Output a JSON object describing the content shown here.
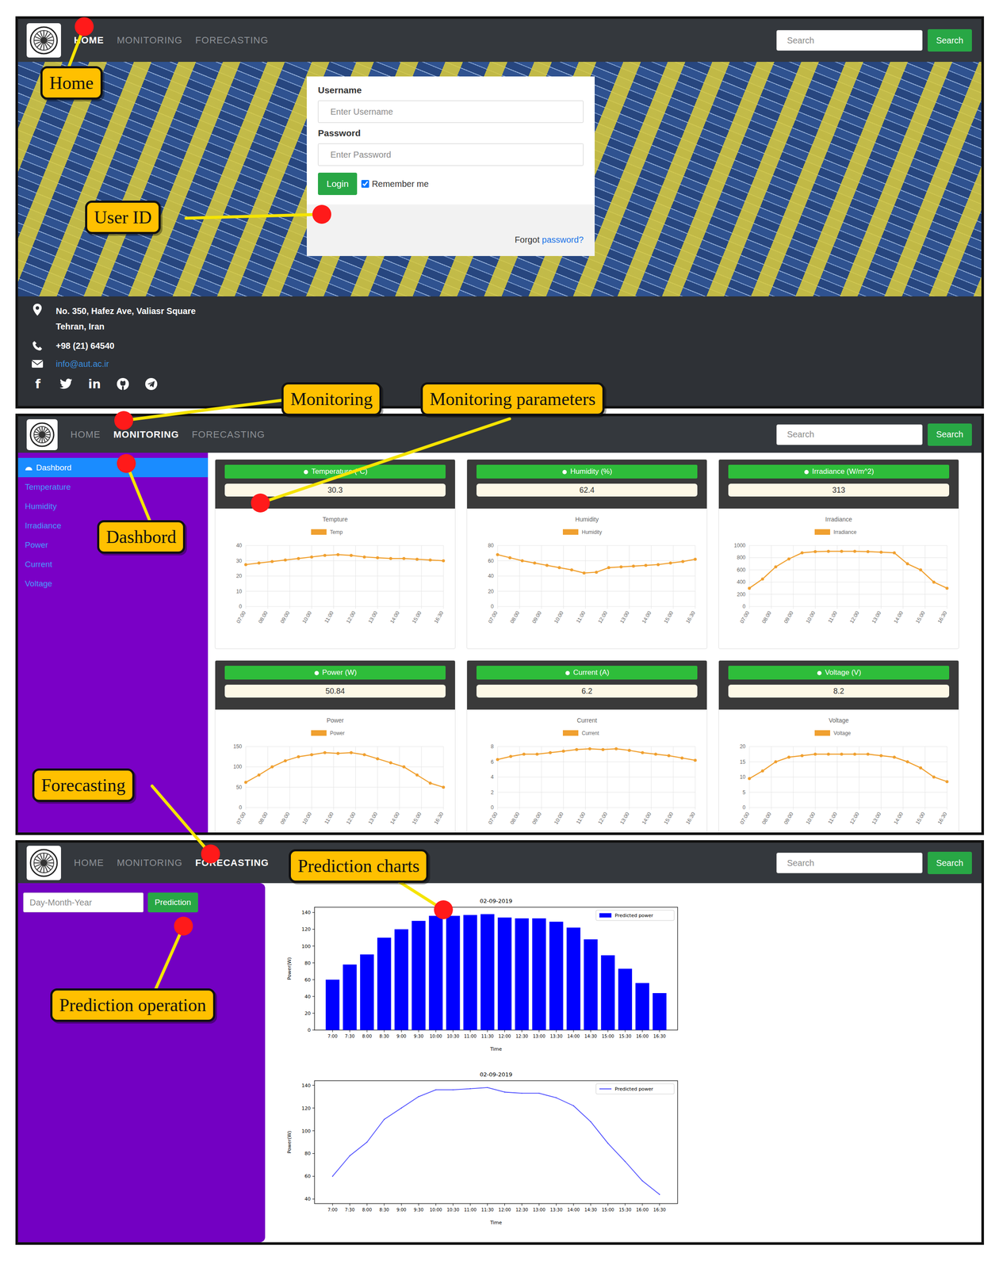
{
  "home": {
    "nav": [
      {
        "label": "HOME",
        "selected": true
      },
      {
        "label": "MONITORING",
        "selected": false
      },
      {
        "label": "FORECASTING",
        "selected": false
      }
    ],
    "search": {
      "placeholder": "Search",
      "button": "Search"
    },
    "login": {
      "username_label": "Username",
      "username_placeholder": "Enter Username",
      "password_label": "Password",
      "password_placeholder": "Enter Password",
      "button": "Login",
      "remember": {
        "label": "Remember me",
        "checked": true
      },
      "forgot": "Forgot",
      "forgot_link": "password?"
    },
    "footer": {
      "address": [
        "No. 350, Hafez Ave, Valiasr Square",
        "Tehran, Iran"
      ],
      "phone": "+98 (21) 64540",
      "email": "info@aut.ac.ir",
      "social": [
        "f",
        "in"
      ]
    }
  },
  "monitoring": {
    "nav": [
      {
        "label": "HOME",
        "selected": false
      },
      {
        "label": "MONITORING",
        "selected": true
      },
      {
        "label": "FORECASTING",
        "selected": false
      }
    ],
    "search": {
      "placeholder": "Search",
      "button": "Search"
    },
    "sidebar": [
      {
        "label": "Dashbord",
        "selected": true
      },
      {
        "label": "Temperature",
        "selected": false
      },
      {
        "label": "Humidity",
        "selected": false
      },
      {
        "label": "Irradiance",
        "selected": false
      },
      {
        "label": "Power",
        "selected": false
      },
      {
        "label": "Current",
        "selected": false
      },
      {
        "label": "Voltage",
        "selected": false
      }
    ],
    "cards": [
      {
        "label": "Temperature (°C)",
        "value": "30.3",
        "chart": {
          "title": "Tempture",
          "legend": "Temp",
          "yticks": [
            "0",
            "10",
            "20",
            "30",
            "40"
          ],
          "xticks": [
            "07:00",
            "08:00",
            "09:00",
            "10:00",
            "11:00",
            "12:00",
            "13:00",
            "14:00",
            "15:00",
            "16:30"
          ],
          "values": [
            27.5,
            28.5,
            29.5,
            30.5,
            31.5,
            32.5,
            33.5,
            34,
            33.5,
            32.5,
            32,
            31.5,
            31.5,
            31,
            30.5,
            30
          ]
        }
      },
      {
        "label": "Humidity (%)",
        "value": "62.4",
        "chart": {
          "title": "Humidity",
          "legend": "Humidity",
          "yticks": [
            "0",
            "20",
            "40",
            "60",
            "80"
          ],
          "xticks": [
            "07:00",
            "08:00",
            "09:00",
            "10:00",
            "11:00",
            "12:00",
            "13:00",
            "14:00",
            "15:00",
            "16:30"
          ],
          "values": [
            68,
            64,
            60,
            57,
            54,
            51,
            48,
            44,
            45,
            51,
            52,
            53,
            54,
            55,
            57,
            59,
            62
          ]
        }
      },
      {
        "label": "Irradiance (W/m^2)",
        "value": "313",
        "chart": {
          "title": "Irradiance",
          "legend": "Irradiance",
          "yticks": [
            "0",
            "200",
            "400",
            "600",
            "800",
            "1000"
          ],
          "xticks": [
            "07:00",
            "08:00",
            "09:00",
            "10:00",
            "11:00",
            "12:00",
            "13:00",
            "14:00",
            "15:00",
            "16:30"
          ],
          "values": [
            300,
            450,
            650,
            780,
            880,
            900,
            905,
            905,
            905,
            900,
            890,
            880,
            700,
            600,
            400,
            300
          ]
        }
      },
      {
        "label": "Power (W)",
        "value": "50.84",
        "chart": {
          "title": "Power",
          "legend": "Power",
          "yticks": [
            "0",
            "50",
            "100",
            "150"
          ],
          "xticks": [
            "07:00",
            "08:00",
            "09:00",
            "10:00",
            "11:00",
            "12:00",
            "13:00",
            "14:00",
            "15:00",
            "16:30"
          ],
          "values": [
            62,
            80,
            100,
            115,
            125,
            130,
            135,
            133,
            135,
            130,
            120,
            110,
            100,
            80,
            60,
            50
          ]
        }
      },
      {
        "label": "Current (A)",
        "value": "6.2",
        "chart": {
          "title": "Current",
          "legend": "Current",
          "yticks": [
            "0",
            "2",
            "4",
            "6",
            "8"
          ],
          "xticks": [
            "07:00",
            "08:00",
            "09:00",
            "10:00",
            "11:00",
            "12:00",
            "13:00",
            "14:00",
            "15:00",
            "16:30"
          ],
          "values": [
            6.3,
            6.7,
            7,
            7,
            7.2,
            7.4,
            7.6,
            7.7,
            7.6,
            7.7,
            7.5,
            7.2,
            7,
            6.8,
            6.5,
            6.2
          ]
        }
      },
      {
        "label": "Voltage (V)",
        "value": "8.2",
        "chart": {
          "title": "Voltage",
          "legend": "Voltage",
          "yticks": [
            "0",
            "5",
            "10",
            "15",
            "20"
          ],
          "xticks": [
            "07:00",
            "08:00",
            "09:00",
            "10:00",
            "11:00",
            "12:00",
            "13:00",
            "14:00",
            "15:00",
            "16:30"
          ],
          "values": [
            9.5,
            12,
            15,
            16.5,
            17,
            17.5,
            17.5,
            17.5,
            17.5,
            17.5,
            17,
            16.5,
            15,
            13,
            10,
            8.5
          ]
        }
      }
    ]
  },
  "forecasting": {
    "nav": [
      {
        "label": "HOME",
        "selected": false
      },
      {
        "label": "MONITORING",
        "selected": false
      },
      {
        "label": "FORECASTING",
        "selected": true
      }
    ],
    "search": {
      "placeholder": "Search",
      "button": "Search"
    },
    "date_placeholder": "Day-Month-Year",
    "button": "Prediction",
    "charts": [
      {
        "kind": "bar",
        "title": "02-09-2019",
        "legend": "Predicted power",
        "ylabel": "Power(W)",
        "xlabel": "Time",
        "yticks": [
          "0",
          "20",
          "40",
          "60",
          "80",
          "100",
          "120",
          "140"
        ],
        "xticks": [
          "7:00",
          "7:30",
          "8:00",
          "8:30",
          "9:00",
          "9:30",
          "10:00",
          "10:30",
          "11:00",
          "11:30",
          "12:00",
          "12:30",
          "13:00",
          "13:30",
          "14:00",
          "14:30",
          "15:00",
          "15:30",
          "16:00",
          "16:30"
        ],
        "values": [
          60,
          78,
          90,
          110,
          120,
          130,
          136,
          136,
          137,
          138,
          134,
          133,
          133,
          129,
          122,
          108,
          89,
          73,
          56,
          44
        ]
      },
      {
        "kind": "line",
        "title": "02-09-2019",
        "legend": "Predicted power",
        "ylabel": "Power(W)",
        "xlabel": "Time",
        "yticks": [
          "40",
          "60",
          "80",
          "100",
          "120",
          "140"
        ],
        "xticks": [
          "7:00",
          "7:30",
          "8:00",
          "8:30",
          "9:00",
          "9:30",
          "10:00",
          "10:30",
          "11:00",
          "11:30",
          "12:00",
          "12:30",
          "13:00",
          "13:30",
          "14:00",
          "14:30",
          "15:00",
          "15:30",
          "16:00",
          "16:30"
        ],
        "values": [
          60,
          78,
          90,
          110,
          120,
          130,
          136,
          136,
          137,
          138,
          134,
          133,
          133,
          129,
          122,
          108,
          89,
          73,
          56,
          44
        ]
      }
    ]
  },
  "callouts": [
    "Home",
    "User ID",
    "Monitoring",
    "Monitoring parameters",
    "Dashbord",
    "Forecasting",
    "Prediction charts",
    "Prediction operation"
  ]
}
